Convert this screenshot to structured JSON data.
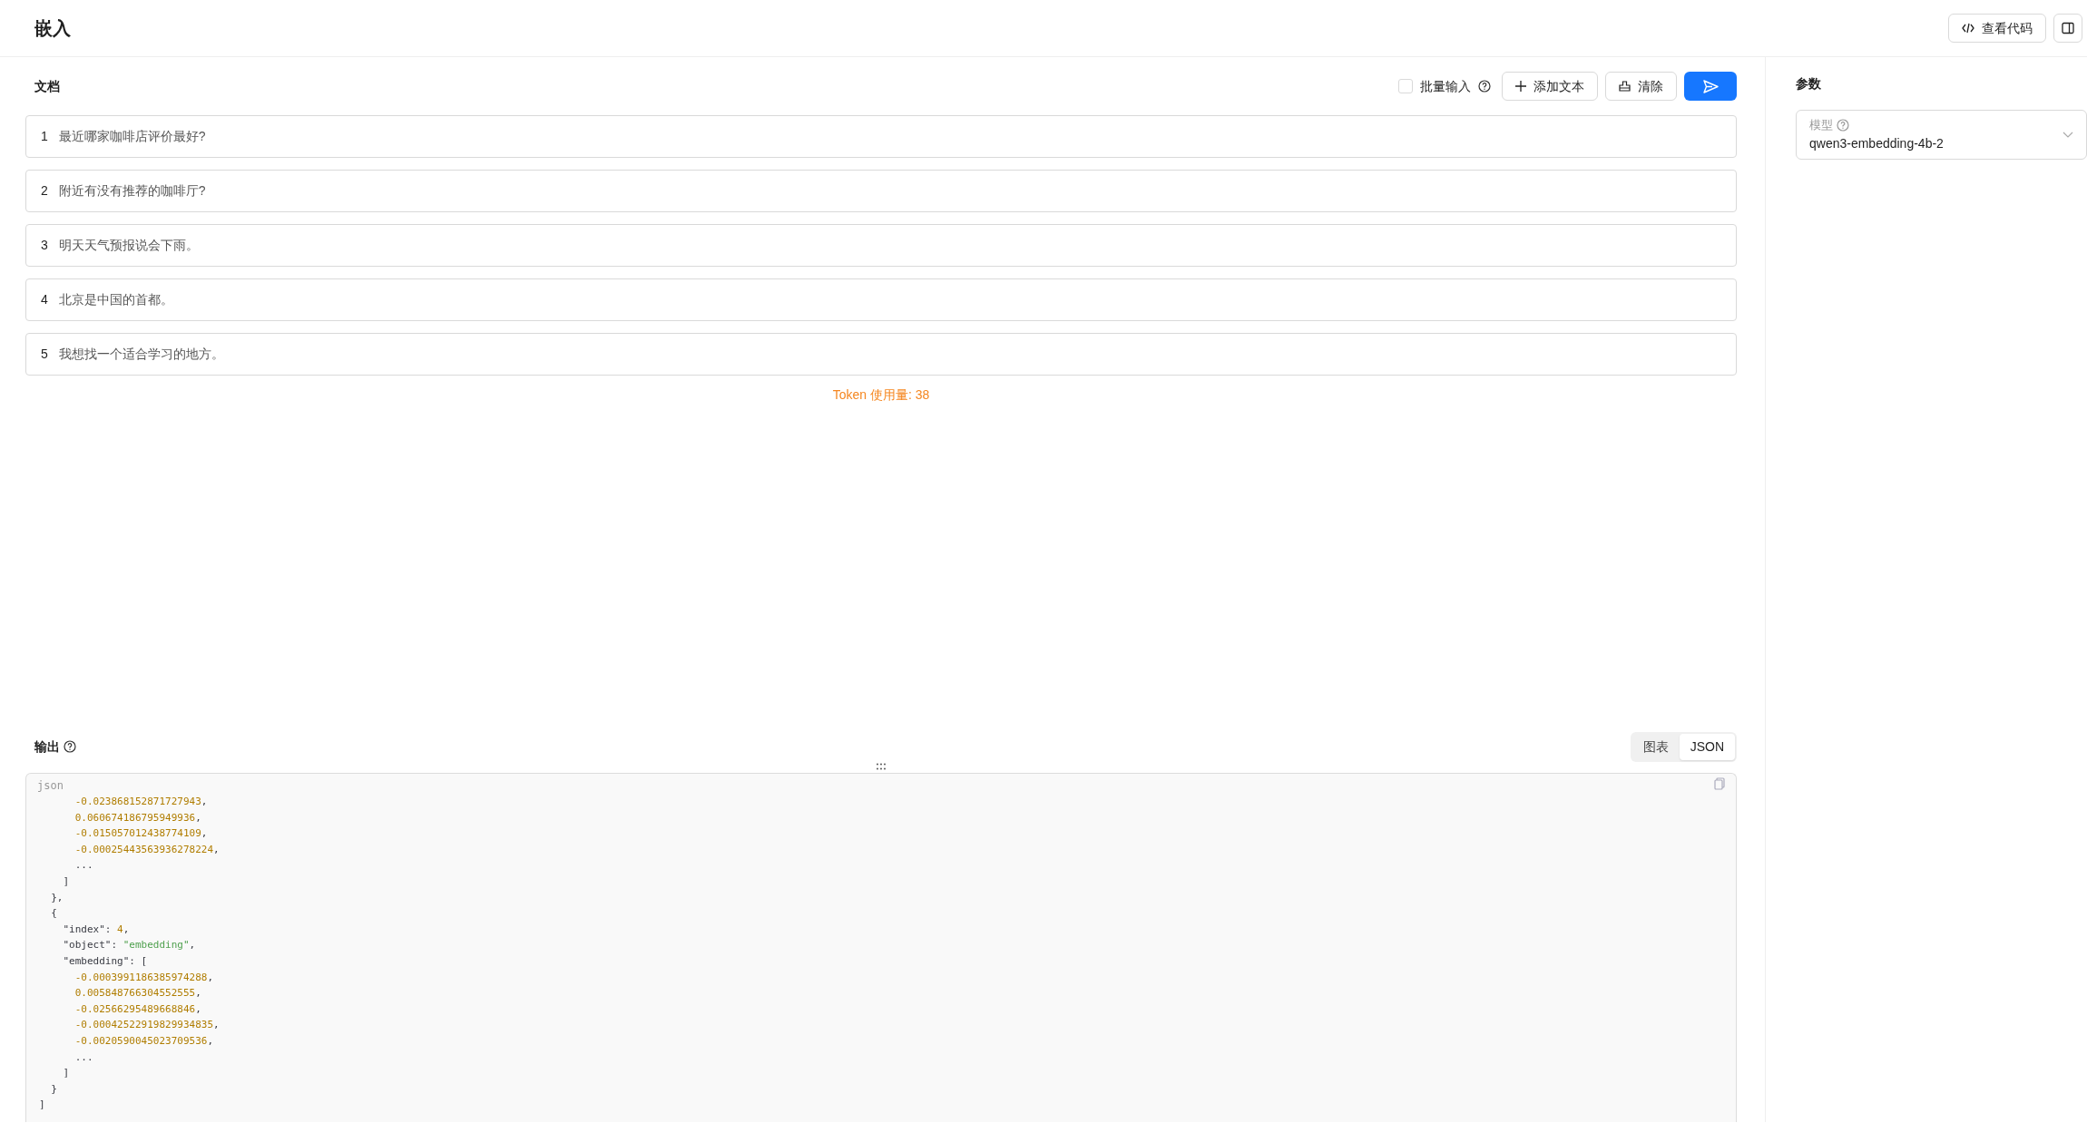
{
  "title": "嵌入",
  "view_code_button": "查看代码",
  "documents": {
    "title": "文档",
    "batch_input": {
      "label": "批量输入",
      "checked": false
    },
    "add_button": "添加文本",
    "clear_button": "清除",
    "items": [
      {
        "number": "1",
        "text": "最近哪家咖啡店评价最好?"
      },
      {
        "number": "2",
        "text": "附近有没有推荐的咖啡厅?"
      },
      {
        "number": "3",
        "text": "明天天气预报说会下雨。"
      },
      {
        "number": "4",
        "text": "北京是中国的首都。"
      },
      {
        "number": "5",
        "text": "我想找一个适合学习的地方。"
      }
    ],
    "token_usage": "Token 使用量: 38"
  },
  "output": {
    "title": "输出",
    "view_toggle": [
      {
        "label": "图表",
        "selected": false
      },
      {
        "label": "JSON",
        "selected": true
      }
    ],
    "code": {
      "language": "json",
      "lines": [
        "      -0.023868152871727943,",
        "      0.060674186795949936,",
        "      -0.015057012438774109,",
        "      -0.00025443563936278224,",
        "      ...",
        "    ]",
        "  },",
        "  {",
        "    \"index\": 4,",
        "    \"object\": \"embedding\",",
        "    \"embedding\": [",
        "      -0.0003991186385974288,",
        "      0.005848766304552555,",
        "      -0.02566295489668846,",
        "      -0.00042522919829934835,",
        "      -0.0020590045023709536,",
        "      ...",
        "    ]",
        "  }",
        "]"
      ]
    }
  },
  "params": {
    "title": "参数",
    "model": {
      "label": "模型",
      "value": "qwen3-embedding-4b-2"
    }
  }
}
